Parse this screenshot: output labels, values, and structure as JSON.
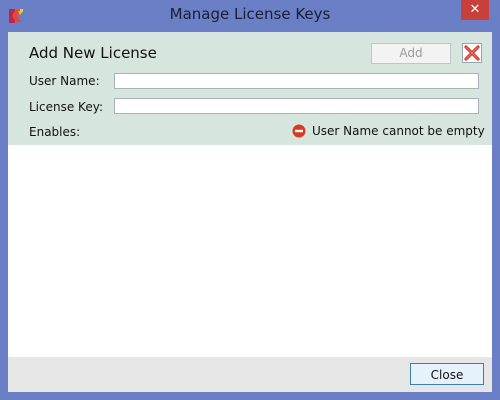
{
  "window": {
    "title": "Manage License Keys"
  },
  "form": {
    "heading": "Add New License",
    "add_label": "Add",
    "user_name_label": "User Name:",
    "user_name_value": "",
    "license_key_label": "License Key:",
    "license_key_value": "",
    "enables_label": "Enables:",
    "error_message": "User Name cannot be empty"
  },
  "footer": {
    "close_label": "Close"
  },
  "colors": {
    "window_frame": "#6a7fc6",
    "panel_bg": "#d6e6df",
    "error_icon": "#d83a22",
    "delete_icon": "#d0302a",
    "close_button_border": "#3c7fb1"
  },
  "icons": {
    "app": "app-logo-icon",
    "delete": "red-x-icon",
    "error": "error-no-entry-icon"
  }
}
